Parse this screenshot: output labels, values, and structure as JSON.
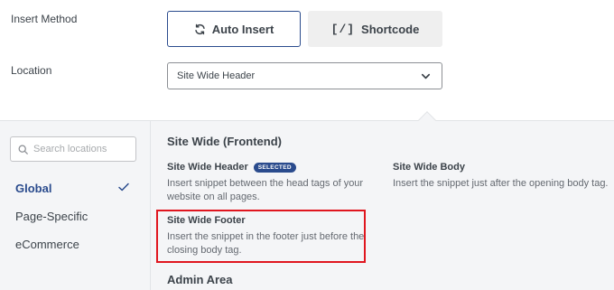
{
  "form": {
    "insert_method_label": "Insert Method",
    "location_label": "Location",
    "buttons": {
      "auto_insert": "Auto Insert",
      "shortcode_glyph": "[/]",
      "shortcode": "Shortcode"
    },
    "location_select_value": "Site Wide Header"
  },
  "sidebar": {
    "search_placeholder": "Search locations",
    "items": [
      {
        "label": "Global",
        "selected": true
      },
      {
        "label": "Page-Specific",
        "selected": false
      },
      {
        "label": "eCommerce",
        "selected": false
      }
    ]
  },
  "content": {
    "section_frontend": "Site Wide (Frontend)",
    "section_admin": "Admin Area",
    "locations": {
      "header": {
        "title": "Site Wide Header",
        "badge": "SELECTED",
        "desc": "Insert snippet between the head tags of your website on all pages."
      },
      "body": {
        "title": "Site Wide Body",
        "desc": "Insert the snippet just after the opening body tag."
      },
      "footer": {
        "title": "Site Wide Footer",
        "desc": "Insert the snippet in the footer just before the closing body tag."
      }
    }
  },
  "colors": {
    "accent": "#2a4b8d",
    "highlight_border": "#e0161f",
    "panel_bg": "#f4f5f7"
  }
}
